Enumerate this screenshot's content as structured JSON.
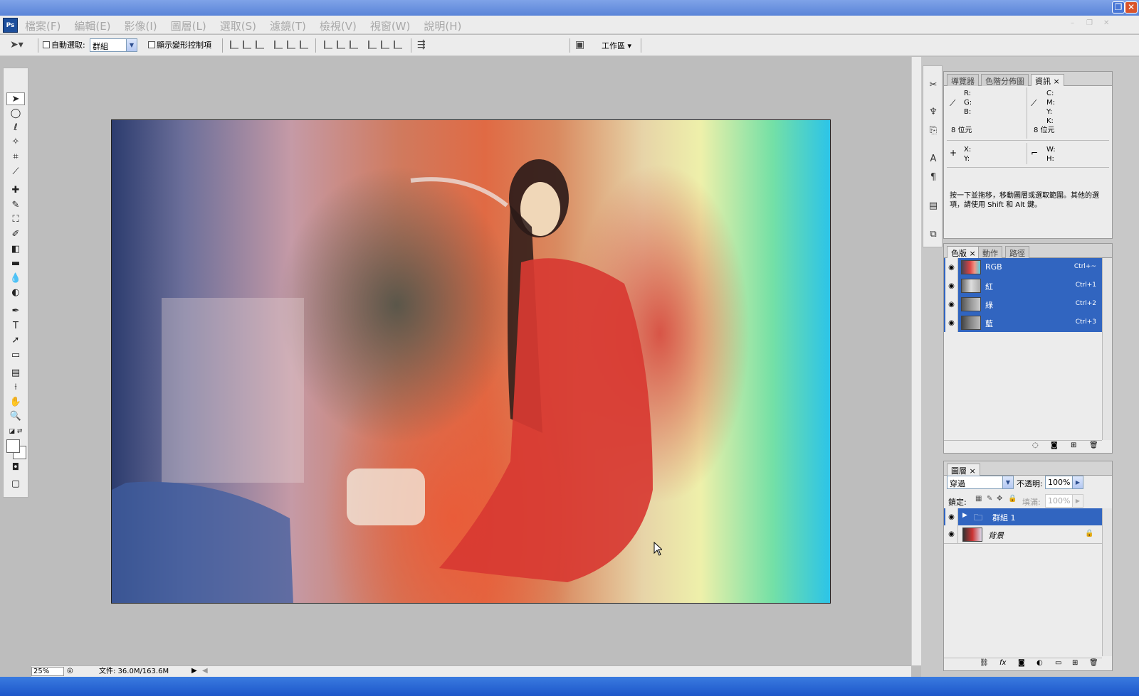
{
  "app": {
    "logo": "Ps"
  },
  "menu": [
    "檔案(F)",
    "編輯(E)",
    "影像(I)",
    "圖層(L)",
    "選取(S)",
    "濾鏡(T)",
    "檢視(V)",
    "視窗(W)",
    "說明(H)"
  ],
  "options_bar": {
    "auto_select_label": "自動選取:",
    "auto_select_value": "群組",
    "show_transform_label": "顯示變形控制項",
    "workspace_label": "工作區"
  },
  "status": {
    "zoom": "25%",
    "doc_info": "文件: 36.0M/163.6M"
  },
  "info_panel": {
    "tabs": [
      "導覽器",
      "色階分佈圖",
      "資訊"
    ],
    "rgb_labels": [
      "R:",
      "G:",
      "B:"
    ],
    "cmyk_labels": [
      "C:",
      "M:",
      "Y:",
      "K:"
    ],
    "bit_left": "8 位元",
    "bit_right": "8 位元",
    "xy_labels": [
      "X:",
      "Y:"
    ],
    "wh_labels": [
      "W:",
      "H:"
    ],
    "hint": "按一下並拖移，移動圖層或選取範圍。其他的選項，請使用 Shift 和 Alt 鍵。"
  },
  "channels_panel": {
    "tabs": [
      "色版",
      "動作",
      "路徑"
    ],
    "channels": [
      {
        "name": "RGB",
        "shortcut": "Ctrl+~"
      },
      {
        "name": "紅",
        "shortcut": "Ctrl+1"
      },
      {
        "name": "綠",
        "shortcut": "Ctrl+2"
      },
      {
        "name": "藍",
        "shortcut": "Ctrl+3"
      }
    ]
  },
  "layers_panel": {
    "tabs": [
      "圖層"
    ],
    "blend_mode": "穿過",
    "opacity_label": "不透明:",
    "opacity": "100%",
    "lock_label": "鎖定:",
    "fill_label": "填滿:",
    "fill": "100%",
    "layers": [
      {
        "name": "群組 1"
      },
      {
        "name": "背景"
      }
    ]
  },
  "colors": {
    "selection_blue": "#3165c0",
    "title_blue": "#5a84d8"
  }
}
